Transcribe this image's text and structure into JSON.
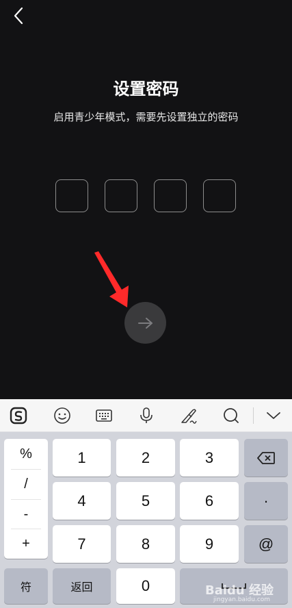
{
  "header": {
    "title": "设置密码",
    "subtitle": "启用青少年模式，需要先设置独立的密码"
  },
  "pin": {
    "length": 4
  },
  "keyboard": {
    "symbols": [
      "%",
      "/",
      "-",
      "+"
    ],
    "digits": [
      "1",
      "2",
      "3",
      "4",
      "5",
      "6",
      "7",
      "8",
      "9",
      "0"
    ],
    "dot": "·",
    "at": "@",
    "fu_label": "符",
    "back_label": "返回"
  },
  "watermark": {
    "text": "Baidu 经验",
    "sub": "jingyan.baidu.com"
  },
  "colors": {
    "screen_bg": "#121214",
    "annotation_arrow": "#ff2a2a",
    "next_button": "#3a3a3c"
  }
}
